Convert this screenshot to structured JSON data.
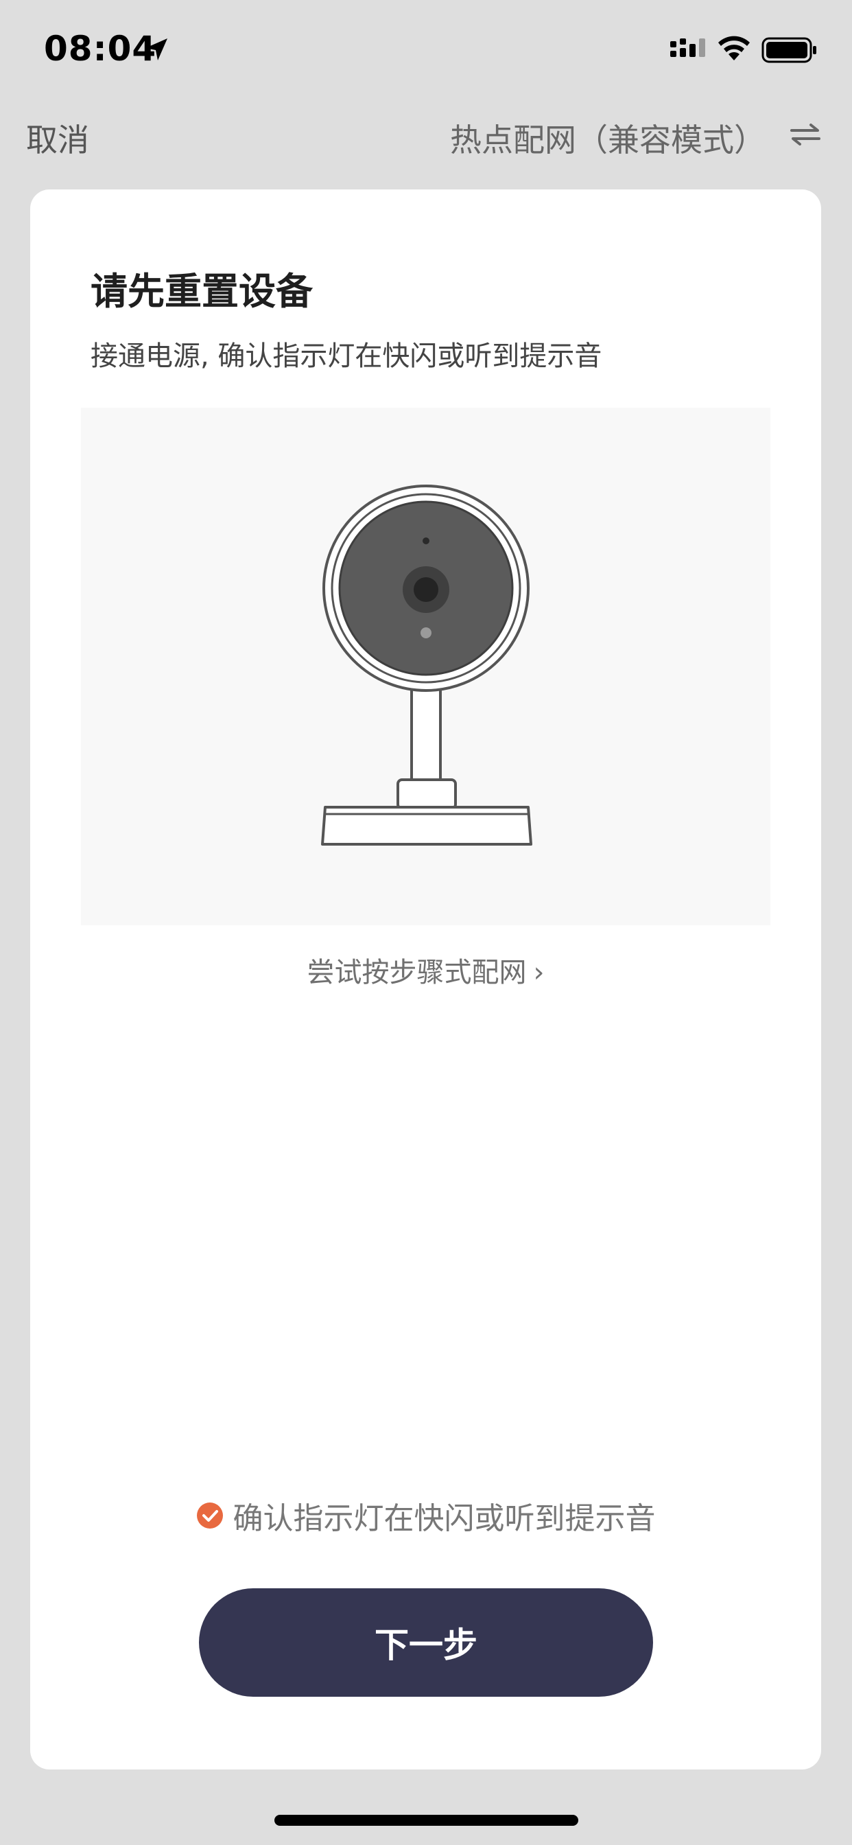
{
  "status_bar": {
    "time": "08:04",
    "icons": [
      "location-arrow-icon",
      "signal-icon",
      "wifi-icon",
      "battery-icon"
    ]
  },
  "nav": {
    "cancel_label": "取消",
    "mode_label": "热点配网（兼容模式）",
    "switch_icon": "switch-arrows-icon"
  },
  "card": {
    "title": "请先重置设备",
    "subtitle": "接通电源, 确认指示灯在快闪或听到提示音",
    "illustration": "security-camera-illustration",
    "step_link_label": "尝试按步骤式配网",
    "confirm_label": "确认指示灯在快闪或听到提示音",
    "confirm_checked": true,
    "next_button_label": "下一步"
  },
  "colors": {
    "background": "#dedede",
    "card": "#ffffff",
    "accent_check": "#e8693f",
    "button": "#353652"
  }
}
